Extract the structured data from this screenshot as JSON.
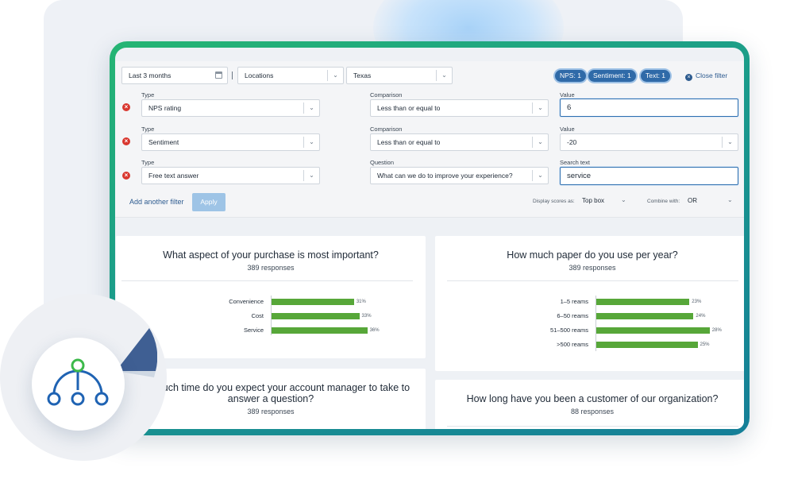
{
  "filters": {
    "date_range": "Last 3 months",
    "locations": "Locations",
    "state": "Texas",
    "chips": [
      "NPS: 1",
      "Sentiment: 1",
      "Text: 1"
    ],
    "close_filter": "Close filter",
    "rows": [
      {
        "type_label": "Type",
        "type_value": "NPS rating",
        "mid_label": "Comparison",
        "mid_value": "Less than or equal to",
        "right_label": "Value",
        "right_value": "6"
      },
      {
        "type_label": "Type",
        "type_value": "Sentiment",
        "mid_label": "Comparison",
        "mid_value": "Less than or equal to",
        "right_label": "Value",
        "right_value": "-20"
      },
      {
        "type_label": "Type",
        "type_value": "Free text answer",
        "mid_label": "Question",
        "mid_value": "What can we do to improve your experience?",
        "right_label": "Search text",
        "right_value": "service"
      }
    ],
    "add_filter": "Add another filter",
    "apply": "Apply",
    "display_scores_label": "Display scores as:",
    "display_scores_value": "Top box",
    "combine_label": "Combine with:",
    "combine_value": "OR"
  },
  "cards": [
    {
      "title": "What aspect of your purchase is most important?",
      "responses": "389 responses",
      "chart_data": {
        "type": "bar",
        "orientation": "horizontal",
        "categories": [
          "Convenience",
          "Cost",
          "Service"
        ],
        "values": [
          31,
          33,
          36
        ],
        "labels": [
          "31%",
          "33%",
          "36%"
        ],
        "unit": "%",
        "color": "#57a739"
      }
    },
    {
      "title": "How much paper do you use per year?",
      "responses": "389 responses",
      "chart_data": {
        "type": "bar",
        "orientation": "horizontal",
        "categories": [
          "1–5 reams",
          "6–50 reams",
          "51–500 reams",
          ">500 reams"
        ],
        "values": [
          23,
          24,
          28,
          25
        ],
        "labels": [
          "23%",
          "24%",
          "28%",
          "25%"
        ],
        "unit": "%",
        "color": "#57a739"
      }
    },
    {
      "title_line1": "How much time do you expect your account manager to take to",
      "title_line2": "answer a question?",
      "responses": "389 responses"
    },
    {
      "title": "How long have you been a customer of our organization?",
      "responses": "88 responses"
    }
  ],
  "icons": {
    "date": "calendar-icon",
    "remove": "remove-circle-icon",
    "close": "close-circle-icon",
    "hierarchy": "hierarchy-icon"
  },
  "colors": {
    "brand_blue": "#2f6aa8",
    "bar_green": "#57a739",
    "remove_red": "#d9372f",
    "frame_green": "#25b573",
    "logo_green": "#3cb94a",
    "logo_blue": "#1f63b3"
  }
}
